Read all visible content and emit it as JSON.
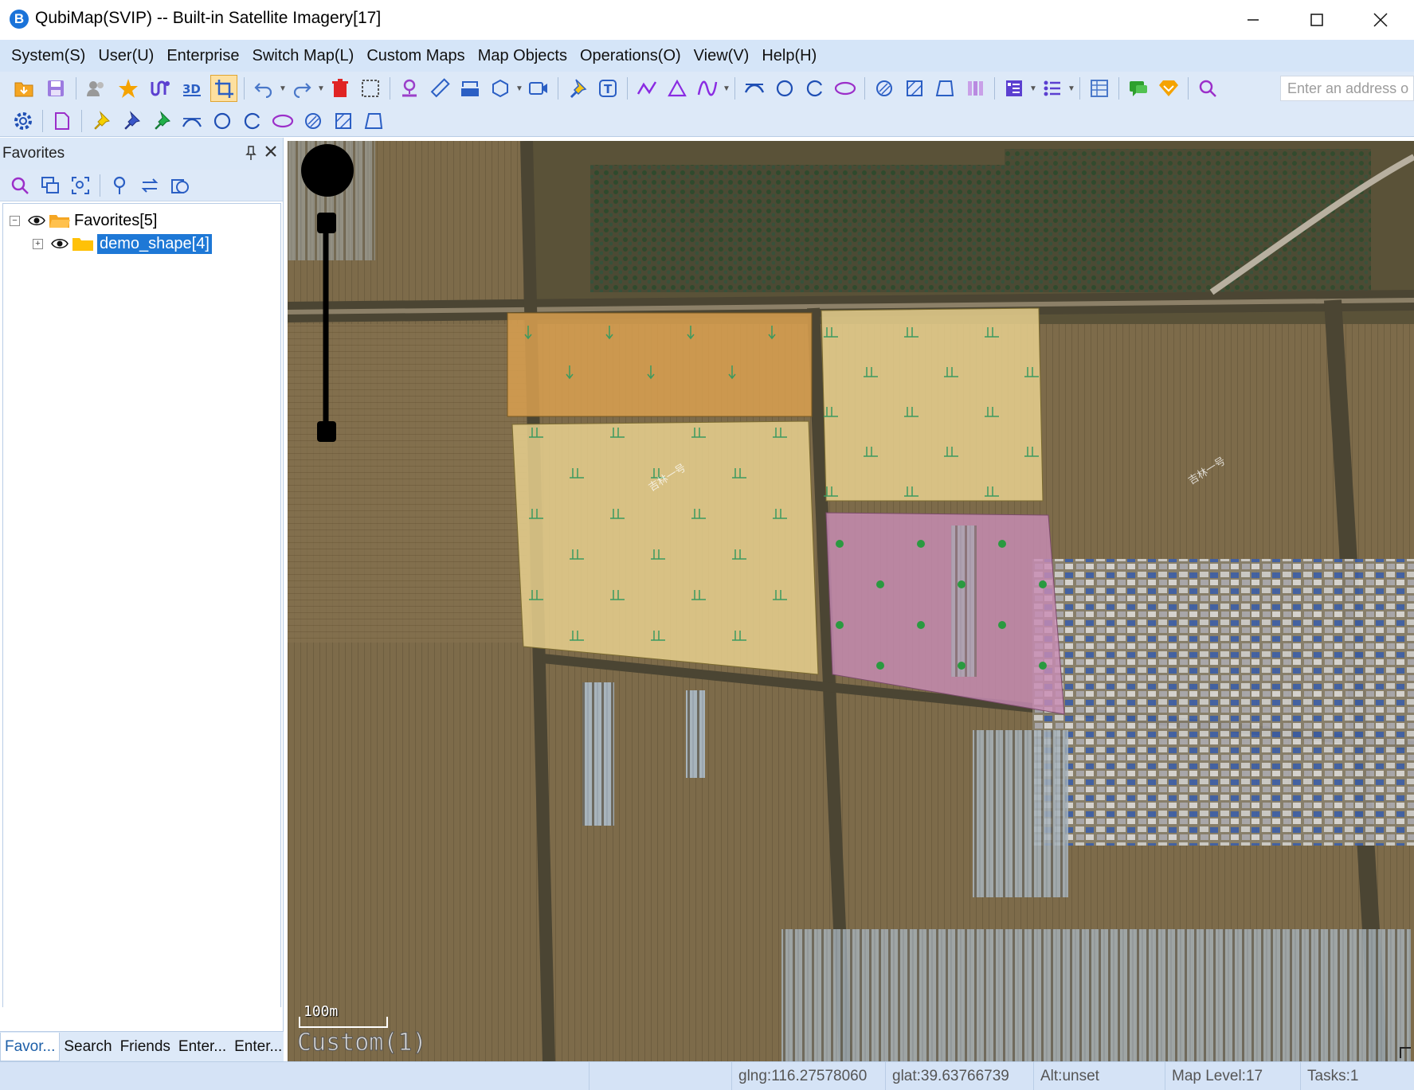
{
  "window": {
    "title": "QubiMap(SVIP) -- Built-in Satellite Imagery[17]",
    "logo_letter": "B"
  },
  "menu": [
    "System(S)",
    "User(U)",
    "Enterprise",
    "Switch Map(L)",
    "Custom Maps",
    "Map Objects",
    "Operations(O)",
    "View(V)",
    "Help(H)"
  ],
  "toolbar": {
    "address_placeholder": "Enter an address o"
  },
  "favorites": {
    "title": "Favorites",
    "tree": [
      {
        "label": "Favorites[5]",
        "expander": "−"
      },
      {
        "label": "demo_shape[4]",
        "expander": "+",
        "selected": true
      }
    ],
    "tabs": [
      "Favor...",
      "Search",
      "Friends",
      "Enter...",
      "Enter..."
    ]
  },
  "map": {
    "scale_label": "100m",
    "custom_label": "Custom(1)",
    "road_labels": [
      "吉林一号",
      "吉林一号"
    ]
  },
  "status": {
    "lng": "glng:116.27578060",
    "lat": "glat:39.63766739",
    "alt": "Alt:unset",
    "level": "Map Level:17",
    "tasks": "Tasks:1"
  },
  "colors": {
    "accent": "#1e78d6",
    "field_orange": "#d9a050",
    "field_tan": "#e8d08e",
    "field_pink": "#c88cb4",
    "crop_mark": "#3a9a60"
  }
}
